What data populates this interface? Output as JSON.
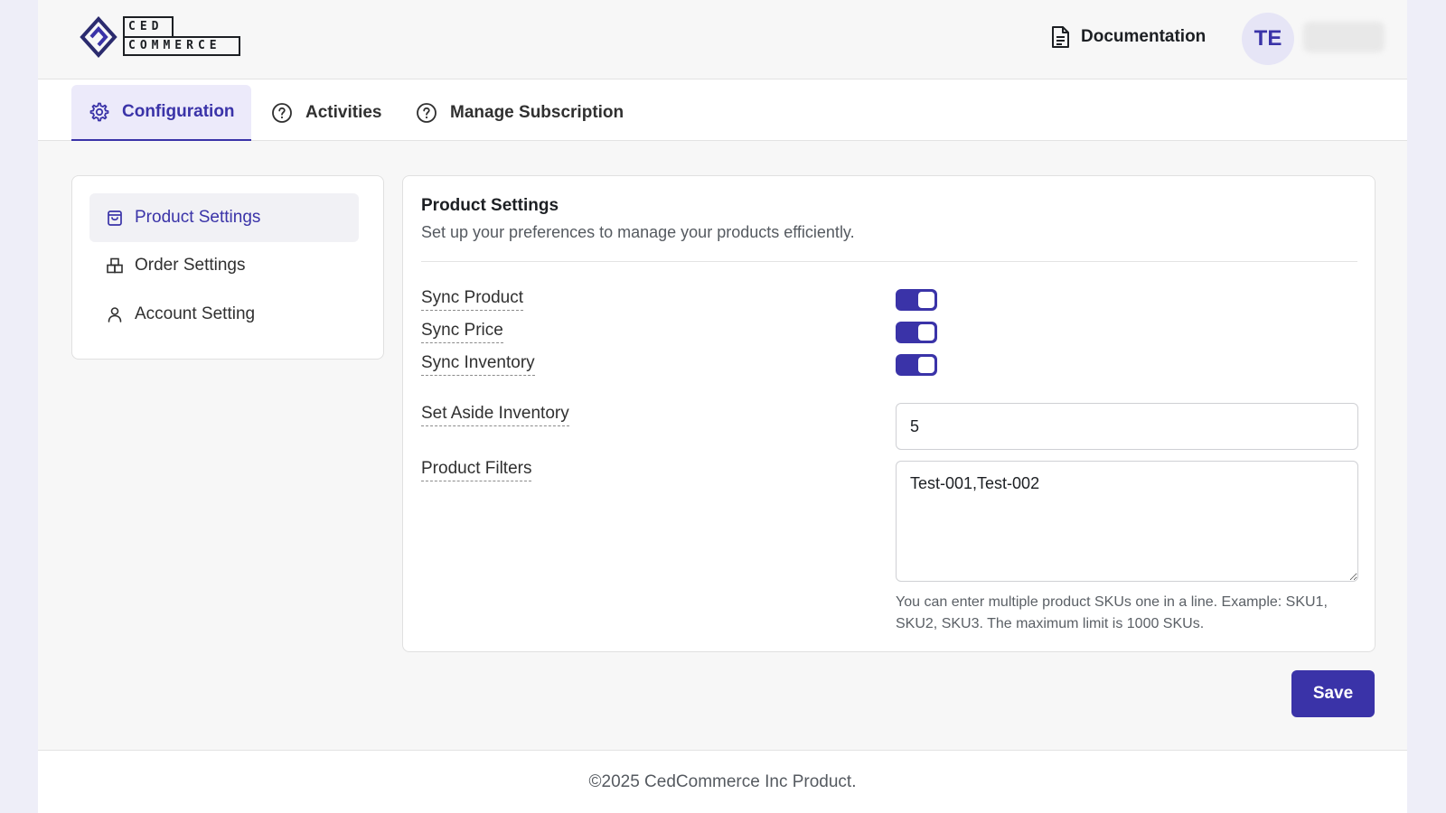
{
  "header": {
    "logo": {
      "line1": "CED",
      "line2": "COMMERCE"
    },
    "documentation_label": "Documentation",
    "avatar_initials": "TE"
  },
  "tabs": [
    {
      "label": "Configuration",
      "icon": "gear-icon",
      "active": true
    },
    {
      "label": "Activities",
      "icon": "question-circle-icon",
      "active": false
    },
    {
      "label": "Manage Subscription",
      "icon": "question-circle-icon",
      "active": false
    }
  ],
  "sidebar": {
    "items": [
      {
        "label": "Product Settings",
        "icon": "shopping-bag-icon",
        "active": true
      },
      {
        "label": "Order Settings",
        "icon": "boxes-icon",
        "active": false
      },
      {
        "label": "Account Setting",
        "icon": "user-icon",
        "active": false
      }
    ]
  },
  "product_settings": {
    "title": "Product Settings",
    "subtitle": "Set up your preferences to manage your products efficiently.",
    "sync_product_label": "Sync Product",
    "sync_price_label": "Sync Price",
    "sync_inventory_label": "Sync Inventory",
    "sync_product_on": true,
    "sync_price_on": true,
    "sync_inventory_on": true,
    "set_aside_inventory_label": "Set Aside Inventory",
    "set_aside_inventory_value": "5",
    "product_filters_label": "Product Filters",
    "product_filters_value": "Test-001,Test-002",
    "product_filters_help": "You can enter multiple product SKUs one in a line. Example: SKU1, SKU2, SKU3. The maximum limit is 1000 SKUs."
  },
  "actions": {
    "save_label": "Save"
  },
  "footer": {
    "copyright": "©2025 CedCommerce Inc Product."
  },
  "colors": {
    "accent": "#3a33a8",
    "accent_light": "#eceafa",
    "background": "#f7f7f7"
  }
}
